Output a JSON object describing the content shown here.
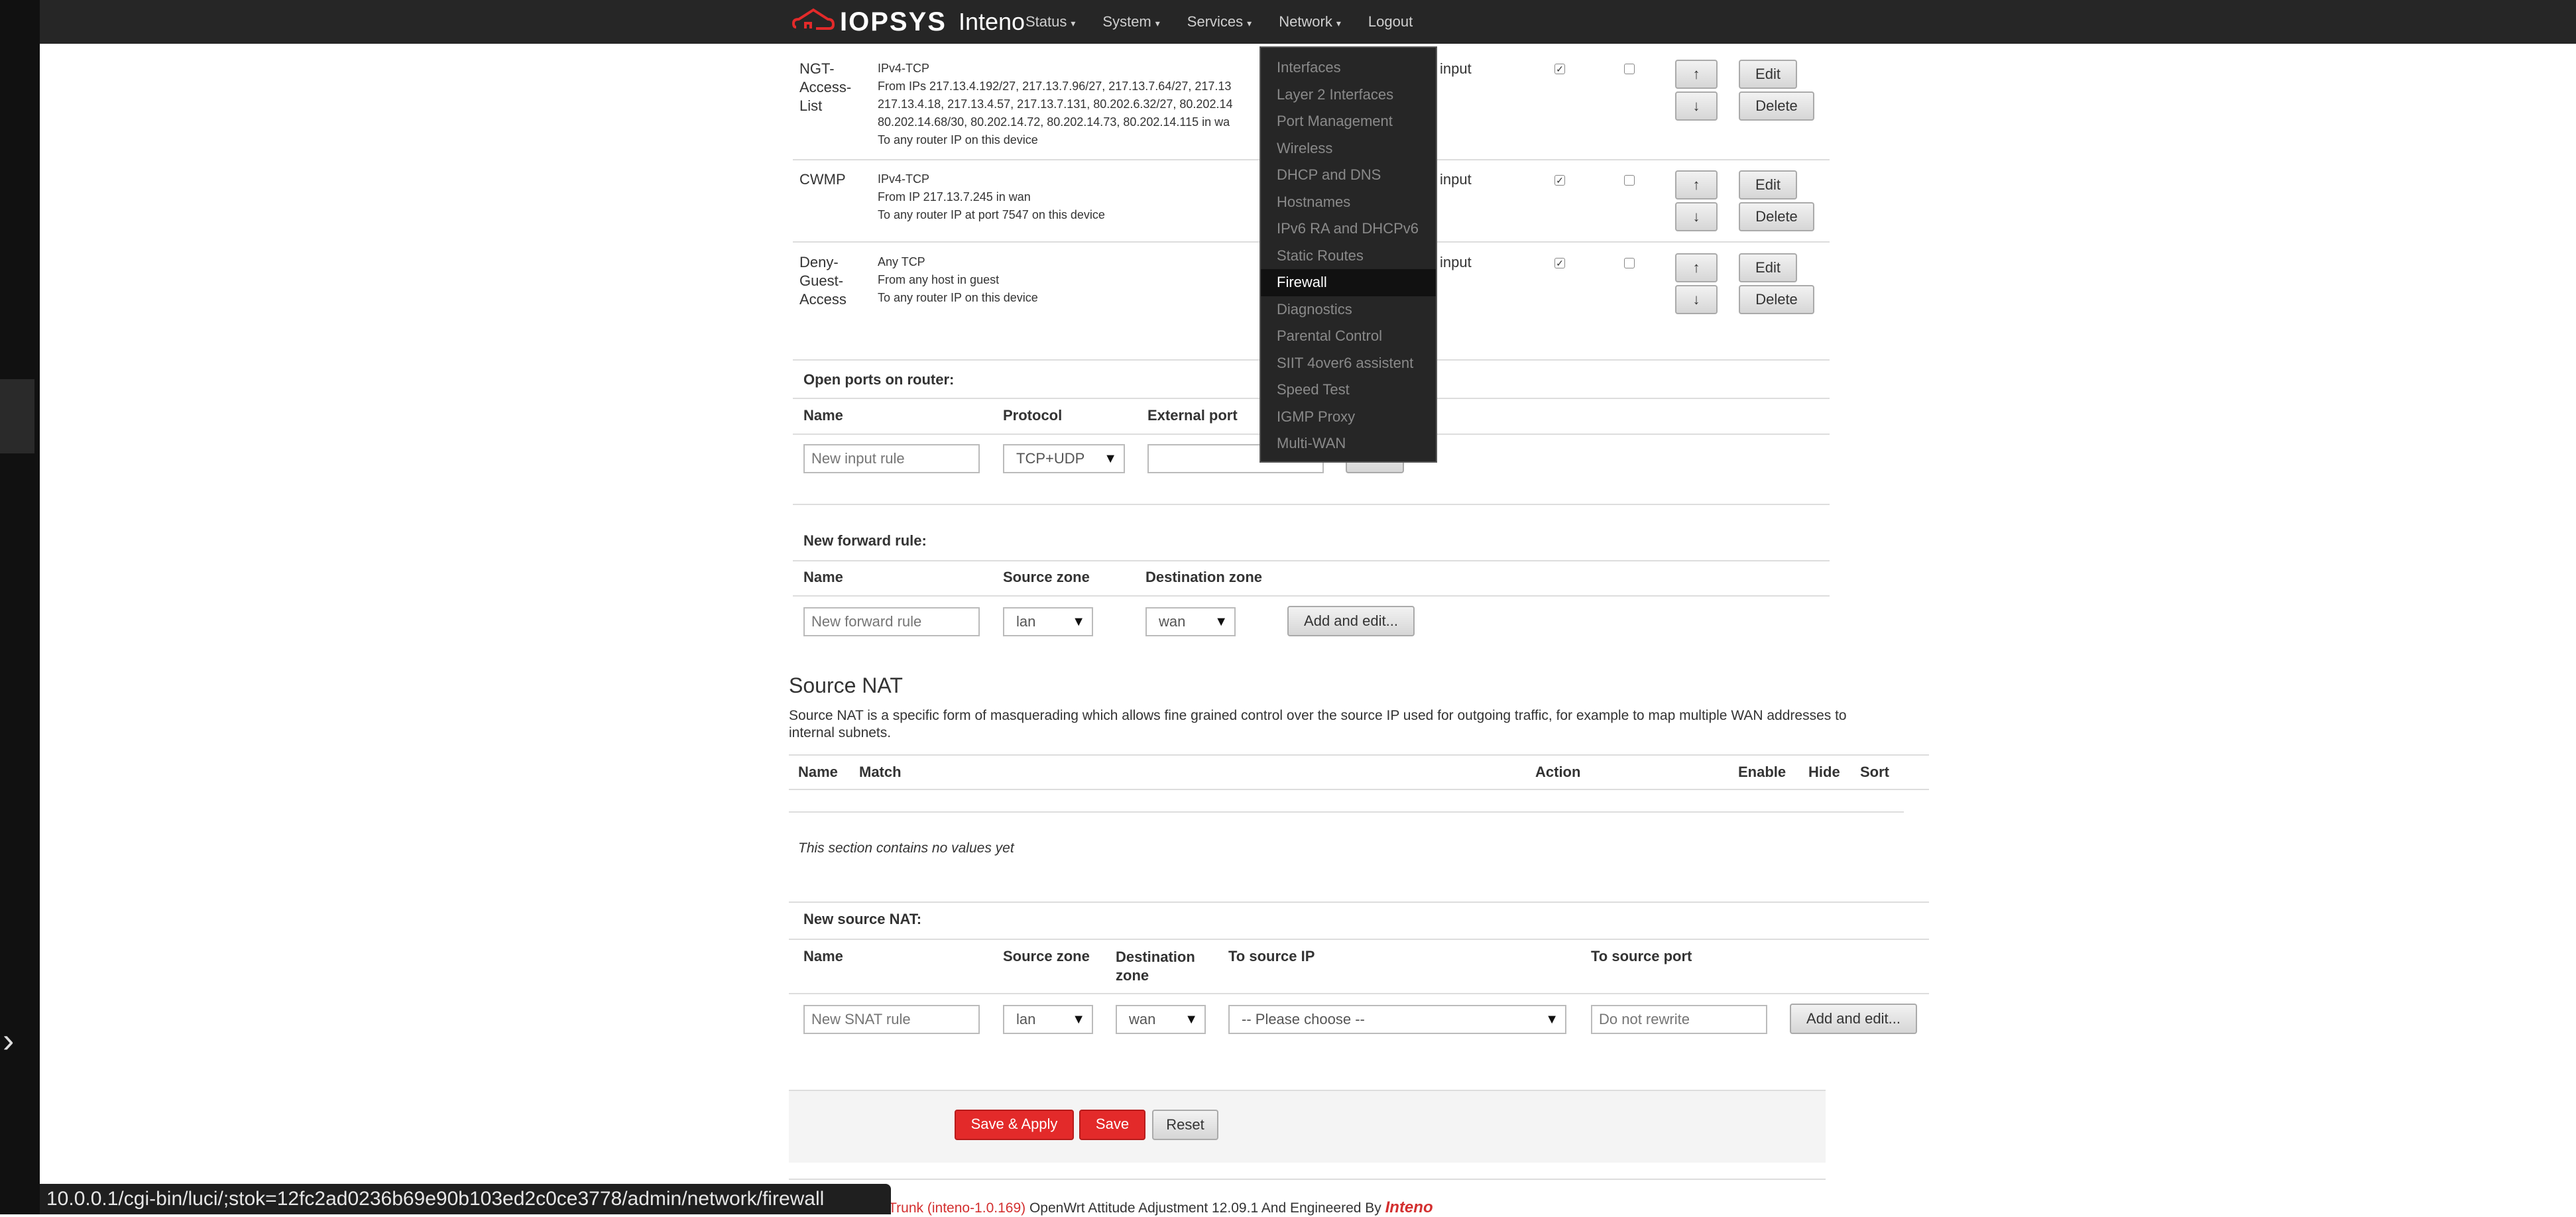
{
  "nav": {
    "brand": "IOPSYS",
    "product": "Inteno",
    "items": [
      "Status",
      "System",
      "Services",
      "Network",
      "Logout"
    ]
  },
  "network_menu": {
    "items": [
      "Interfaces",
      "Layer 2 Interfaces",
      "Port Management",
      "Wireless",
      "DHCP and DNS",
      "Hostnames",
      "IPv6 RA and DHCPv6",
      "Static Routes",
      "Firewall",
      "Diagnostics",
      "Parental Control",
      "SIIT 4over6 assistent",
      "Speed Test",
      "IGMP Proxy",
      "Multi-WAN"
    ],
    "active": "Firewall"
  },
  "rules": [
    {
      "name": [
        "NGT-",
        "Access-",
        "List"
      ],
      "lines": [
        "IPv4-TCP",
        "From IPs 217.13.4.192/27, 217.13.7.96/27, 217.13.7.64/27, 217.13",
        "217.13.4.18, 217.13.4.57, 217.13.7.131, 80.202.6.32/27, 80.202.14",
        "80.202.14.68/30, 80.202.14.72, 80.202.14.73, 80.202.14.115 in wa",
        "To any router IP on this device"
      ],
      "action": "input",
      "enabled": true,
      "hidden": false
    },
    {
      "name": [
        "CWMP"
      ],
      "lines": [
        "IPv4-TCP",
        "From IP 217.13.7.245 in wan",
        "To any router IP at port 7547 on this device"
      ],
      "action": "input",
      "enabled": true,
      "hidden": false
    },
    {
      "name": [
        "Deny-",
        "Guest-",
        "Access"
      ],
      "lines": [
        "Any TCP",
        "From any host in guest",
        "To any router IP on this device"
      ],
      "action": "input",
      "enabled": true,
      "hidden": false
    }
  ],
  "buttons": {
    "up": "↑",
    "down": "↓",
    "edit": "Edit",
    "delete": "Delete"
  },
  "open_ports": {
    "title": "Open ports on router:",
    "col_name": "Name",
    "col_protocol": "Protocol",
    "col_external_port": "External port",
    "name_placeholder": "New input rule",
    "protocol_value": "TCP+UDP"
  },
  "forward": {
    "title": "New forward rule:",
    "col_name": "Name",
    "col_source": "Source zone",
    "col_dest": "Destination zone",
    "name_placeholder": "New forward rule",
    "source_value": "lan",
    "dest_value": "wan",
    "add_button": "Add and edit..."
  },
  "snat": {
    "heading": "Source NAT",
    "desc1": "Source NAT is a specific form of masquerading which allows fine grained control over the source IP used for outgoing traffic, for example to map multiple WAN addresses to",
    "desc2": "internal subnets.",
    "cols": {
      "name": "Name",
      "match": "Match",
      "action": "Action",
      "enable": "Enable",
      "hide": "Hide",
      "sort": "Sort"
    },
    "empty": "This section contains no values yet"
  },
  "new_snat": {
    "title": "New source NAT:",
    "col_name": "Name",
    "col_source": "Source zone",
    "col_dest1": "Destination",
    "col_dest2": "zone",
    "col_to_ip": "To source IP",
    "col_to_port": "To source port",
    "name_placeholder": "New SNAT rule",
    "source_value": "lan",
    "dest_value": "wan",
    "to_ip_value": "-- Please choose --",
    "to_port_placeholder": "Do not rewrite",
    "add_button": "Add and edit..."
  },
  "actions": {
    "save_apply": "Save & Apply",
    "save": "Save",
    "reset": "Reset"
  },
  "footer": {
    "trunk": "l Trunk (inteno-1.0.169)",
    "text": "OpenWrt Attitude Adjustment 12.09.1 And Engineered By",
    "logo": "Inteno"
  },
  "status_url": "10.0.0.1/cgi-bin/luci/;stok=12fc2ad0236b69e90b103ed2c0ce3778/admin/network/firewall",
  "colors": {
    "navbar": "#262626",
    "accent_red": "#e32a2a"
  }
}
